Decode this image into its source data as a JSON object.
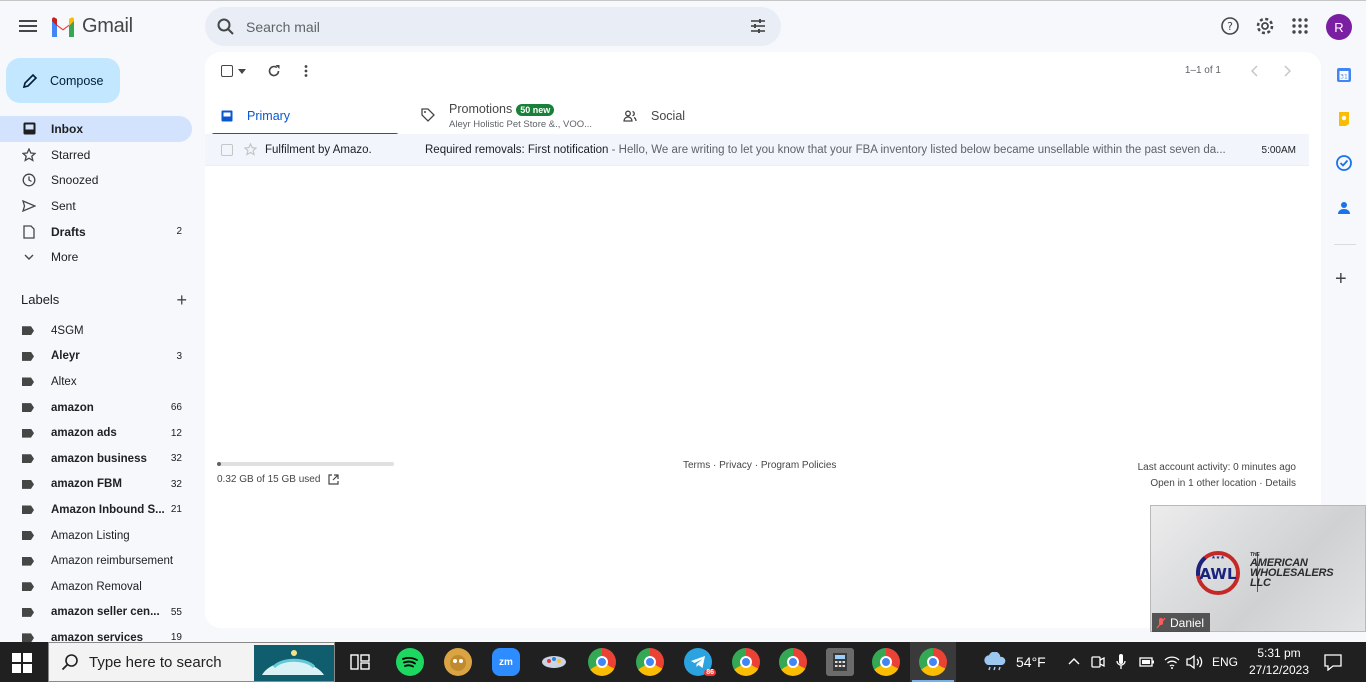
{
  "app": {
    "name": "Gmail"
  },
  "search": {
    "placeholder": "Search mail"
  },
  "profile": {
    "initial": "R"
  },
  "compose": {
    "label": "Compose"
  },
  "nav": {
    "items": [
      {
        "label": "Inbox",
        "count": ""
      },
      {
        "label": "Starred",
        "count": ""
      },
      {
        "label": "Snoozed",
        "count": ""
      },
      {
        "label": "Sent",
        "count": ""
      },
      {
        "label": "Drafts",
        "count": "2"
      },
      {
        "label": "More",
        "count": ""
      }
    ]
  },
  "labels": {
    "header": "Labels",
    "items": [
      {
        "label": "4SGM",
        "count": ""
      },
      {
        "label": "Aleyr",
        "count": "3"
      },
      {
        "label": "Altex",
        "count": ""
      },
      {
        "label": "amazon",
        "count": "66"
      },
      {
        "label": "amazon ads",
        "count": "12"
      },
      {
        "label": "amazon business",
        "count": "32"
      },
      {
        "label": "amazon FBM",
        "count": "32"
      },
      {
        "label": "Amazon Inbound S...",
        "count": "21"
      },
      {
        "label": "Amazon Listing",
        "count": ""
      },
      {
        "label": "Amazon reimbursement",
        "count": ""
      },
      {
        "label": "Amazon Removal",
        "count": ""
      },
      {
        "label": "amazon seller cen...",
        "count": "55"
      },
      {
        "label": "amazon services",
        "count": "19"
      }
    ]
  },
  "toolbar": {
    "pager": "1–1 of 1"
  },
  "tabs": {
    "primary": "Primary",
    "promotions": "Promotions",
    "promotions_badge": "50 new",
    "promotions_sub": "Aleyr Holistic Pet Store &., VOO...",
    "social": "Social"
  },
  "emails": [
    {
      "sender": "Fulfilment by Amazo.",
      "subject": "Required removals: First notification",
      "snippet": " - Hello, We are writing to let you know that your FBA inventory listed below became unsellable within the past seven da...",
      "time": "5:00AM"
    }
  ],
  "storage": {
    "text": "0.32 GB of 15 GB used",
    "used_fraction": 0.021
  },
  "footer": {
    "terms": "Terms",
    "privacy": "Privacy",
    "policies": "Program Policies",
    "sep": " · "
  },
  "activity": {
    "line1": "Last account activity: 0 minutes ago",
    "line2_a": "Open in 1 other location",
    "line2_sep": " · ",
    "line2_b": "Details"
  },
  "video": {
    "company_line1": "THE",
    "company_line2": "AMERICAN",
    "company_line3": "WHOLESALERS",
    "company_line4": "LLC",
    "logo_text": "AWL",
    "participant": "Daniel"
  },
  "taskbar": {
    "search_placeholder": "Type here to search",
    "weather": "54°F",
    "language": "ENG",
    "time": "5:31 pm",
    "date": "27/12/2023",
    "telegram_badge": "86"
  },
  "colors": {
    "accent": "#0b57d0",
    "compose": "#c2e7ff",
    "selected": "#d3e3fd",
    "avatar": "#7a1fa2",
    "promo_badge": "#188038"
  }
}
